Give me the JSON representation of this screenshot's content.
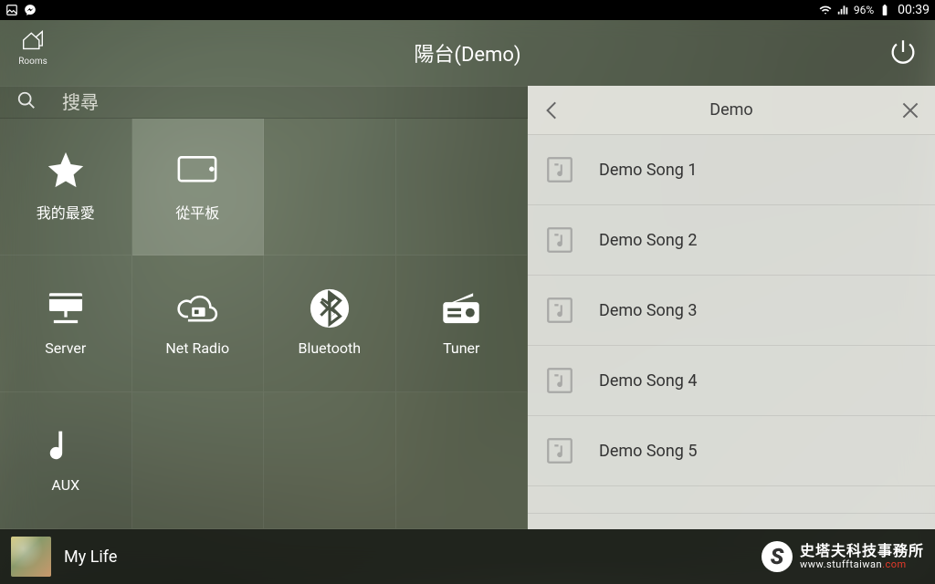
{
  "status": {
    "battery": "96%",
    "time": "00:39"
  },
  "header": {
    "rooms_label": "Rooms",
    "title": "陽台(Demo)"
  },
  "search": {
    "placeholder": "搜尋"
  },
  "tiles": [
    {
      "id": "favorites",
      "label": "我的最愛",
      "icon": "star"
    },
    {
      "id": "tablet",
      "label": "從平板",
      "icon": "tablet",
      "selected": true
    },
    {
      "id": "server",
      "label": "Server",
      "icon": "server"
    },
    {
      "id": "netradio",
      "label": "Net Radio",
      "icon": "cloud-radio"
    },
    {
      "id": "bluetooth",
      "label": "Bluetooth",
      "icon": "bluetooth"
    },
    {
      "id": "tuner",
      "label": "Tuner",
      "icon": "radio"
    },
    {
      "id": "aux",
      "label": "AUX",
      "icon": "note"
    }
  ],
  "list": {
    "title": "Demo",
    "items": [
      {
        "name": "Demo Song 1"
      },
      {
        "name": "Demo Song 2"
      },
      {
        "name": "Demo Song 3"
      },
      {
        "name": "Demo Song 4"
      },
      {
        "name": "Demo Song 5"
      }
    ]
  },
  "now_playing": {
    "track": "My Life"
  },
  "watermark": {
    "cn": "史塔夫科技事務所",
    "url_base": "www.stufftaiwan",
    "url_tld": ".com"
  }
}
